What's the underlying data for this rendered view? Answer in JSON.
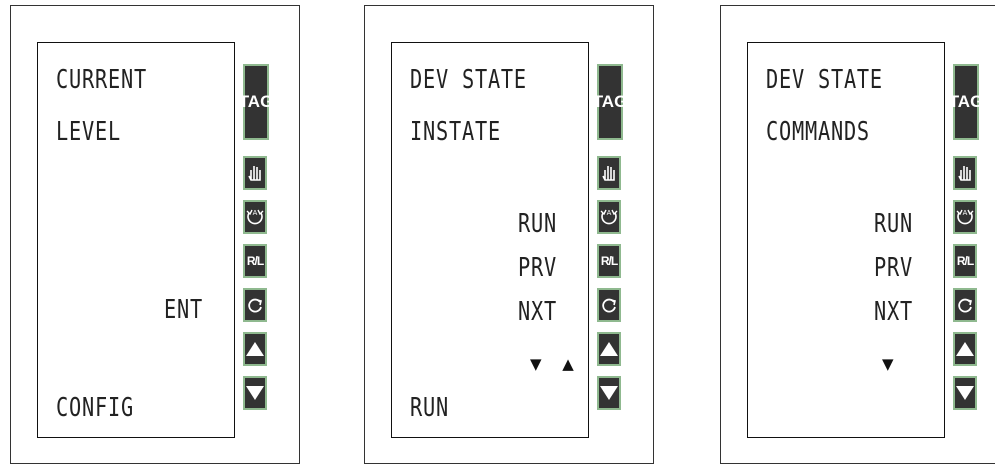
{
  "devices": [
    {
      "lines": [
        "CURRENT",
        "LEVEL"
      ],
      "soft_keys": [
        "ENT"
      ],
      "arrows": "",
      "bottom": "CONFIG"
    },
    {
      "lines": [
        "DEV STATE",
        "INSTATE"
      ],
      "soft_keys": [
        "RUN",
        "PRV",
        "NXT"
      ],
      "arrows": "▼ ▲",
      "bottom": "RUN"
    },
    {
      "lines": [
        "DEV STATE",
        "COMMANDS"
      ],
      "soft_keys": [
        "RUN",
        "PRV",
        "NXT"
      ],
      "arrows": "▼",
      "bottom": ""
    }
  ],
  "buttons": {
    "tag_label": "TAG",
    "rl_label": "R/L",
    "icons": [
      "hand-icon",
      "auto-cycle-icon",
      "refresh-icon",
      "up-arrow-icon",
      "down-arrow-icon"
    ]
  },
  "colors": {
    "button_bg": "#333333",
    "button_border": "#8fb98f",
    "lcd_text": "#222222"
  }
}
